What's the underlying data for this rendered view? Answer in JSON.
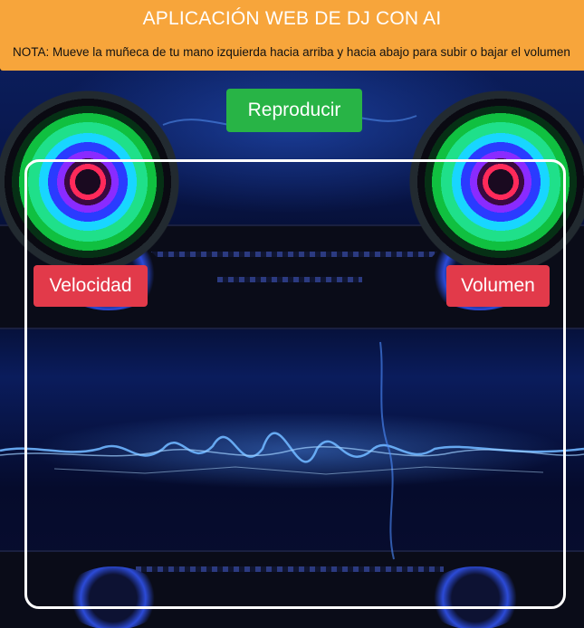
{
  "header": {
    "title": "APLICACIÓN WEB DE DJ CON AI",
    "note": "NOTA: Mueve la muñeca de tu mano izquierda hacia arriba y hacia abajo para subir o bajar el volumen"
  },
  "controls": {
    "play_label": "Reproducir",
    "speed_label": "Velocidad",
    "volume_label": "Volumen"
  },
  "colors": {
    "header": "#f7a53b",
    "play_button": "#28b446",
    "control_buttons": "#e23a4a"
  }
}
